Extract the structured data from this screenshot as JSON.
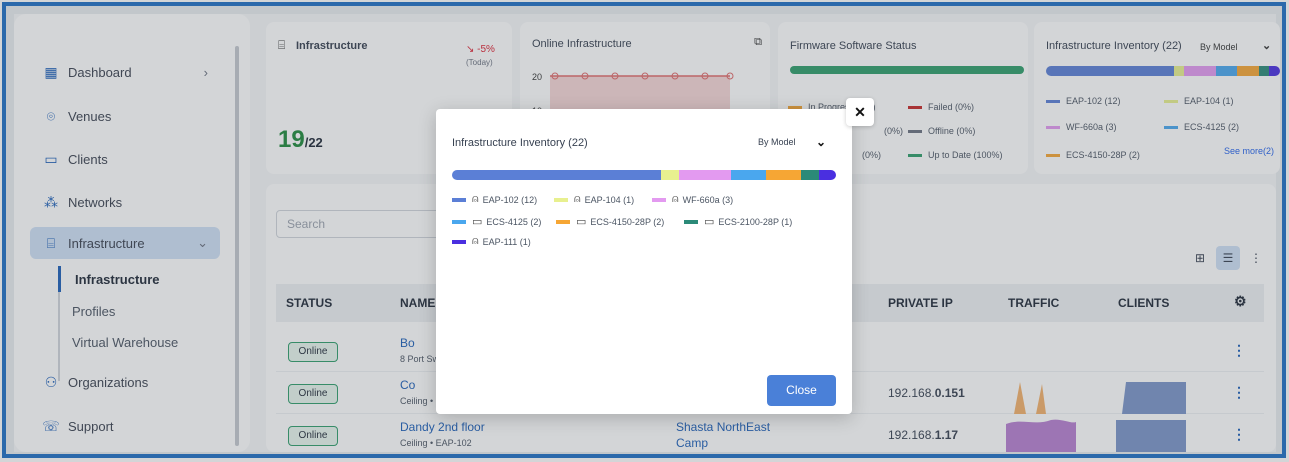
{
  "sidebar": {
    "items": [
      {
        "label": "Dashboard",
        "icon": "dashboard-icon"
      },
      {
        "label": "Venues",
        "icon": "location-pin-icon"
      },
      {
        "label": "Clients",
        "icon": "devices-icon"
      },
      {
        "label": "Networks",
        "icon": "network-icon"
      },
      {
        "label": "Infrastructure",
        "icon": "router-icon"
      },
      {
        "label": "Organizations",
        "icon": "people-icon"
      },
      {
        "label": "Support",
        "icon": "support-icon"
      }
    ],
    "sub": [
      "Infrastructure",
      "Profiles",
      "Virtual Warehouse"
    ]
  },
  "cards": {
    "infra": {
      "title": "Infrastructure",
      "trend": "↘ -5%",
      "trend_sub": "(Today)",
      "count": "19",
      "total": "/22"
    },
    "online": {
      "title": "Online Infrastructure",
      "tick_20": "20",
      "tick_10": "10"
    },
    "firmware": {
      "title": "Firmware Software Status",
      "leg": [
        "In Progress (0%)",
        "Failed (0%)",
        "(0%)",
        "Offline (0%)",
        "(0%)",
        "Up to Date (100%)"
      ]
    },
    "inventory": {
      "title": "Infrastructure Inventory (22)",
      "select": "By Model",
      "leg": [
        "EAP-102 (12)",
        "EAP-104 (1)",
        "WF-660a (3)",
        "ECS-4125 (2)",
        "ECS-4150-28P (2)"
      ],
      "see_more": "See more(2)"
    }
  },
  "main": {
    "search_placeholder": "Search",
    "columns": [
      "STATUS",
      "NAME",
      "PRIVATE IP",
      "TRAFFIC",
      "CLIENTS"
    ],
    "rows": [
      {
        "status": "Online",
        "name": "Bo",
        "sub": "8 Port Swi",
        "ip_pre": "",
        "ip_bold": ""
      },
      {
        "status": "Online",
        "name": "Co",
        "sub": "Ceiling •",
        "ip_pre": "192.168.",
        "ip_bold": "0.151"
      },
      {
        "status": "Online",
        "name": "Dandy 2nd floor",
        "sub": "Ceiling • EAP-102",
        "ip_pre": "192.168.",
        "ip_bold": "1.17",
        "site": "Shasta NorthEast",
        "site2": "Camp"
      }
    ]
  },
  "modal": {
    "title": "Infrastructure Inventory (22)",
    "select": "By Model",
    "close_label": "Close",
    "legend": [
      {
        "label": "EAP-102 (12)",
        "color": "#5b7fd6",
        "value": 12
      },
      {
        "label": "EAP-104 (1)",
        "color": "#e8f08f",
        "value": 1
      },
      {
        "label": "WF-660a (3)",
        "color": "#e39af0",
        "value": 3
      },
      {
        "label": "ECS-4125 (2)",
        "color": "#4aa7ee",
        "value": 2
      },
      {
        "label": "ECS-4150-28P (2)",
        "color": "#f6a634",
        "value": 2
      },
      {
        "label": "ECS-2100-28P (1)",
        "color": "#2b8a78",
        "value": 1
      },
      {
        "label": "EAP-111 (1)",
        "color": "#4a2fe0",
        "value": 1
      }
    ]
  }
}
